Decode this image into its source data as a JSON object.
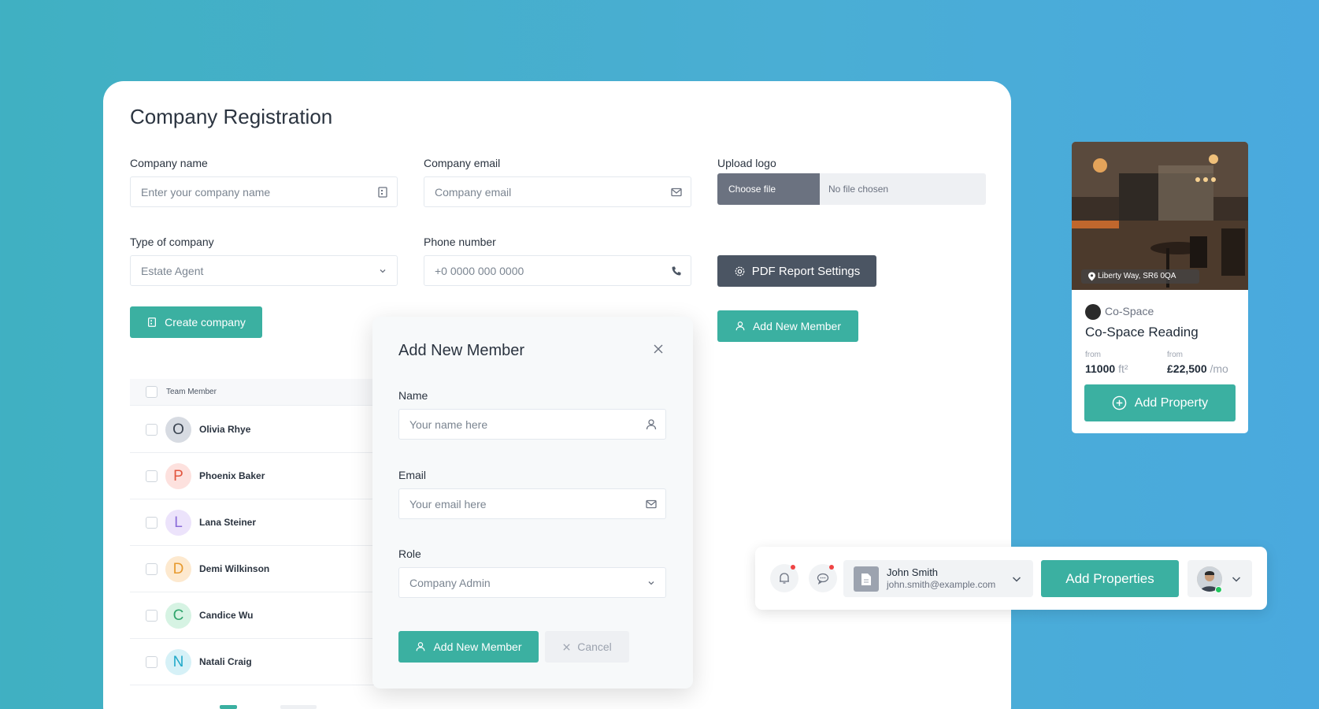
{
  "company_form": {
    "title": "Company Registration",
    "company_name_label": "Company name",
    "company_name_placeholder": "Enter your company name",
    "company_email_label": "Company email",
    "company_email_placeholder": "Company email",
    "upload_logo_label": "Upload logo",
    "choose_file": "Choose file",
    "no_file": "No file chosen",
    "type_label": "Type of company",
    "type_value": "Estate Agent",
    "phone_label": "Phone number",
    "phone_placeholder": "+0 0000 000 0000",
    "pdf_button": "PDF Report Settings",
    "create_button": "Create company",
    "add_member_button": "Add New Member"
  },
  "team_table": {
    "header": "Team Member",
    "rows": [
      {
        "initial": "O",
        "name": "Olivia Rhye",
        "bg": "#d7dbe2",
        "fg": "#3b4451"
      },
      {
        "initial": "P",
        "name": "Phoenix Baker",
        "bg": "#fde1de",
        "fg": "#e2553f"
      },
      {
        "initial": "L",
        "name": "Lana Steiner",
        "bg": "#ece3fb",
        "fg": "#8b6cd9"
      },
      {
        "initial": "D",
        "name": "Demi Wilkinson",
        "bg": "#fde9cf",
        "fg": "#e79a2f"
      },
      {
        "initial": "C",
        "name": "Candice Wu",
        "bg": "#d6f3e3",
        "fg": "#2fa56b"
      },
      {
        "initial": "N",
        "name": "Natali Craig",
        "bg": "#d6f1f7",
        "fg": "#21a9c9"
      }
    ]
  },
  "modal": {
    "title": "Add New Member",
    "name_label": "Name",
    "name_placeholder": "Your name here",
    "email_label": "Email",
    "email_placeholder": "Your email here",
    "role_label": "Role",
    "role_value": "Company Admin",
    "submit_button": "Add New Member",
    "cancel_button": "Cancel"
  },
  "property_card": {
    "location": "Liberty Way, SR6 0QA",
    "brand": "Co-Space",
    "name": "Co-Space Reading",
    "size_from_label": "from",
    "size_value": "11000",
    "size_unit": "ft²",
    "price_from_label": "from",
    "price_value": "£22,500",
    "price_unit": "/mo",
    "add_button": "Add Property"
  },
  "header_bar": {
    "user_name": "John Smith",
    "user_email": "john.smith@example.com",
    "add_button": "Add Properties"
  },
  "colors": {
    "accent": "#3bb0a1",
    "dark_button": "#4b5563",
    "notification_dot": "#ef4444",
    "online_dot": "#22c55e"
  }
}
